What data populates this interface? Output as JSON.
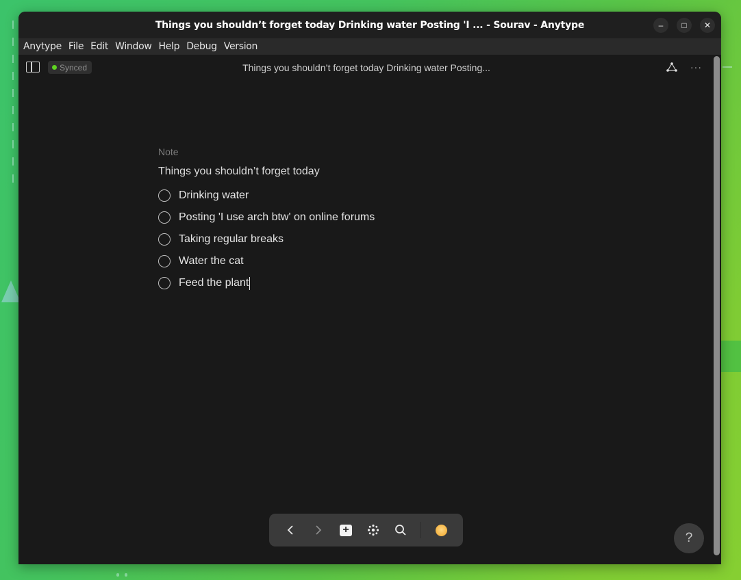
{
  "window": {
    "title": "Things you shouldn’t forget today Drinking water Posting 'I ... - Sourav - Anytype",
    "controls": {
      "minimize": "–",
      "maximize": "□",
      "close": "✕"
    }
  },
  "menu": [
    "Anytype",
    "File",
    "Edit",
    "Window",
    "Help",
    "Debug",
    "Version"
  ],
  "header": {
    "sync_status": "Synced",
    "sync_color": "#5fd321",
    "breadcrumb_title": "Things you shouldn’t forget today Drinking water Posting...",
    "more_icon": "···"
  },
  "document": {
    "type_label": "Note",
    "title": "Things you shouldn’t forget today",
    "tasks": [
      {
        "label": "Drinking water",
        "checked": false
      },
      {
        "label": "Posting 'I use arch btw' on online forums",
        "checked": false
      },
      {
        "label": "Taking regular breaks",
        "checked": false
      },
      {
        "label": "Water the cat",
        "checked": false
      },
      {
        "label": "Feed the plant",
        "checked": false
      }
    ]
  },
  "navbar": {
    "back": "back-icon",
    "forward": "forward-icon",
    "create": "+",
    "graph": "graph-icon",
    "search": "search-icon",
    "profile": "avatar"
  },
  "help": {
    "label": "?"
  }
}
